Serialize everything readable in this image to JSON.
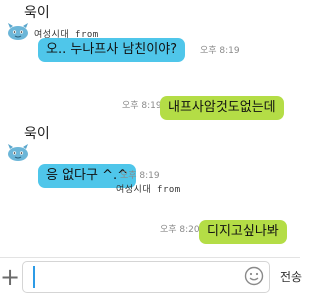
{
  "messages": [
    {
      "sender": "욱이",
      "text": "오.. 누나프사 남친이야?",
      "time": "오후 8:19",
      "watermark": "여성시대 from"
    },
    {
      "text": "내프사암것도없는데",
      "time": "오후 8:19"
    },
    {
      "sender": "욱이",
      "text": "응 없다구 ^.^",
      "time": "오후 8:19",
      "watermark": "여성시대 from"
    },
    {
      "text": "디지고싶나봐",
      "time": "오후 8:20"
    }
  ],
  "input_bar": {
    "send_label": "전송"
  },
  "colors": {
    "incoming_bubble": "#4fc6ea",
    "outgoing_bubble": "#b4dd46",
    "avatar": "#6cb6d8"
  }
}
